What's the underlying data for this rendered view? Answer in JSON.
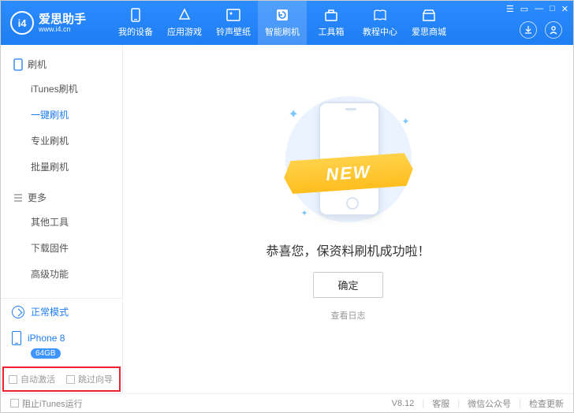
{
  "logo": {
    "mark": "i4",
    "title": "爱思助手",
    "subtitle": "www.i4.cn"
  },
  "nav": [
    {
      "label": "我的设备"
    },
    {
      "label": "应用游戏"
    },
    {
      "label": "铃声壁纸"
    },
    {
      "label": "智能刷机"
    },
    {
      "label": "工具箱"
    },
    {
      "label": "教程中心"
    },
    {
      "label": "爱思商城"
    }
  ],
  "sidebar": {
    "group1": {
      "title": "刷机",
      "items": [
        "iTunes刷机",
        "一键刷机",
        "专业刷机",
        "批量刷机"
      ],
      "activeIndex": 1
    },
    "group2": {
      "title": "更多",
      "items": [
        "其他工具",
        "下载固件",
        "高级功能"
      ]
    },
    "mode": "正常模式",
    "device": {
      "name": "iPhone 8",
      "storage": "64GB"
    },
    "checkboxes": {
      "auto_activate": "自动激活",
      "skip_guide": "跳过向导"
    }
  },
  "main": {
    "ribbon": "NEW",
    "success": "恭喜您，保资料刷机成功啦！",
    "confirm": "确定",
    "log": "查看日志"
  },
  "footer": {
    "block_itunes": "阻止iTunes运行",
    "version": "V8.12",
    "support": "客服",
    "wechat": "微信公众号",
    "update": "检查更新"
  }
}
